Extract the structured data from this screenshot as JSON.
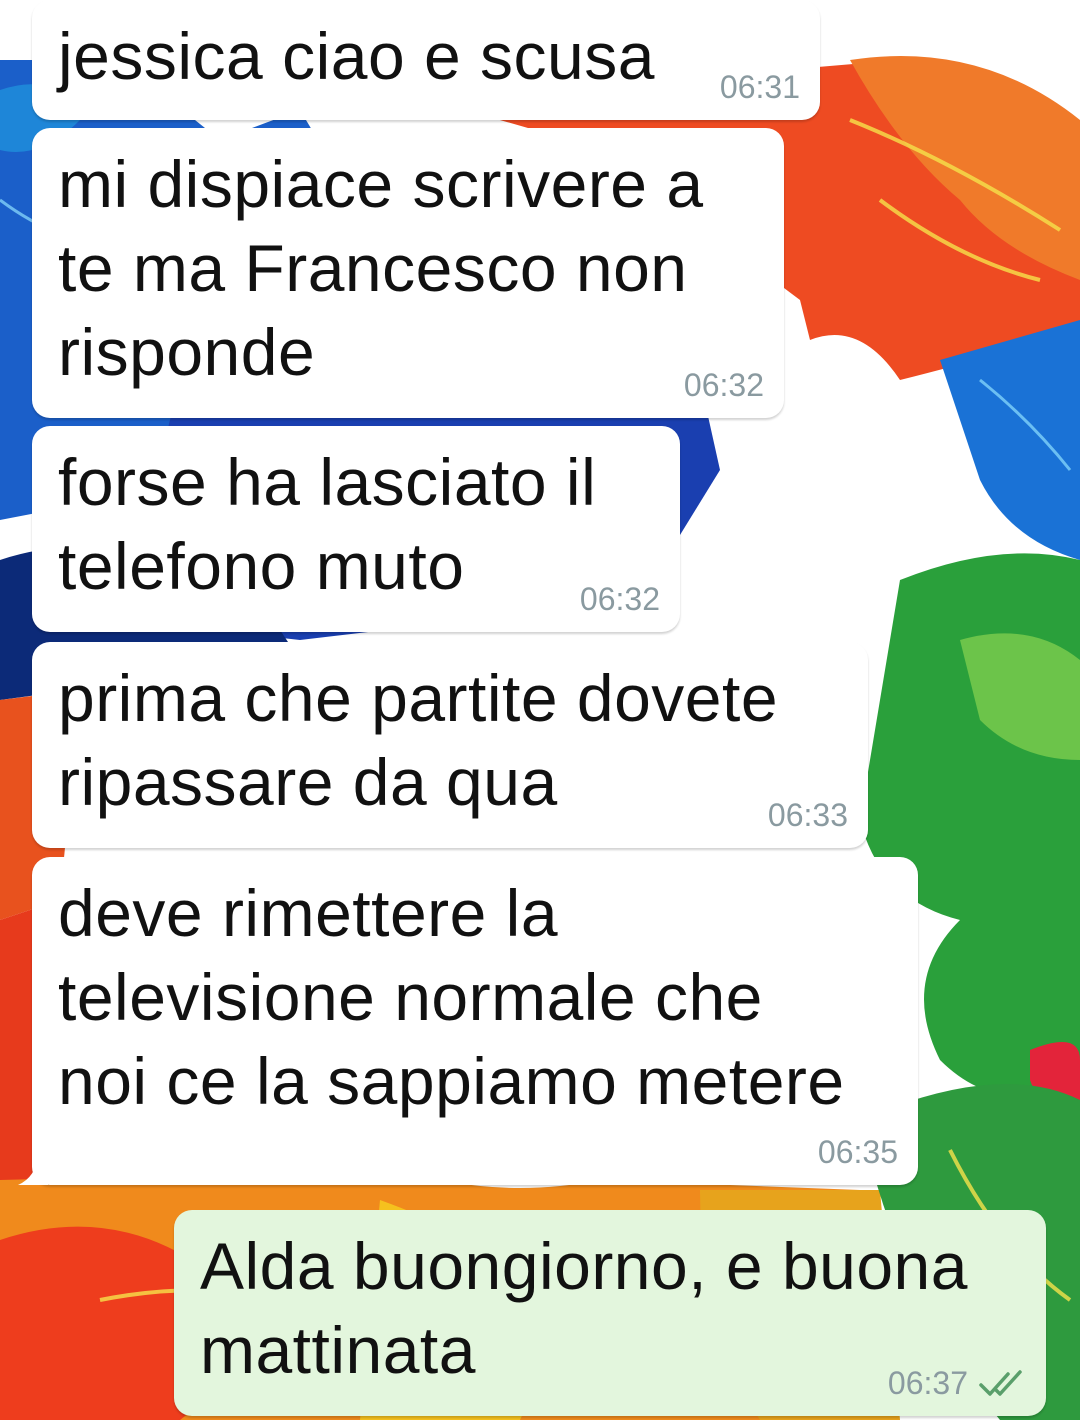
{
  "chat": {
    "messages": [
      {
        "direction": "incoming",
        "text": "jessica ciao e scusa",
        "time": "06:31"
      },
      {
        "direction": "incoming",
        "text": "mi dispiace scrivere a\nte ma Francesco non\nrisponde",
        "time": "06:32"
      },
      {
        "direction": "incoming",
        "text": "forse ha lasciato il\ntelefono muto",
        "time": "06:32"
      },
      {
        "direction": "incoming",
        "text": "prima che partite dovete\nripassare da qua",
        "time": "06:33"
      },
      {
        "direction": "incoming",
        "text": "deve rimettere la\ntelevisione normale che\nnoi ce la sappiamo metere",
        "time": "06:35"
      },
      {
        "direction": "outgoing",
        "text": "Alda buongiorno, e buona\nmattinata",
        "time": "06:37",
        "status_icon": "double-check-read-icon"
      }
    ]
  },
  "theme": {
    "incoming_bubble": "#ffffff",
    "outgoing_bubble": "#e3f6dd",
    "read_ticks": "#5a9f6b",
    "wallpaper_colors": [
      "#e8391f",
      "#1f6fd1",
      "#2a9a3a",
      "#f08a1c",
      "#f5d21e"
    ]
  }
}
